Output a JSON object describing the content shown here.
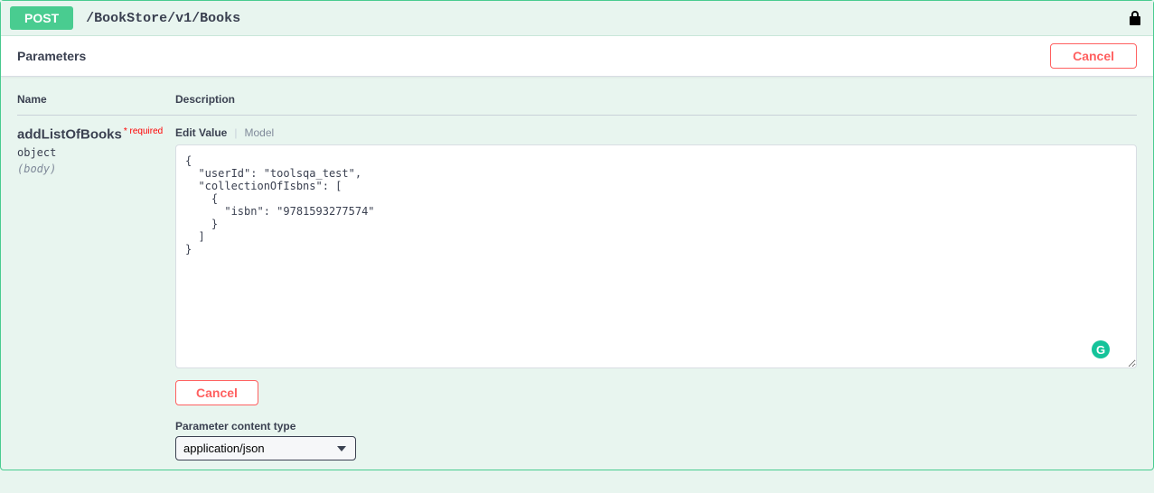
{
  "op": {
    "method": "POST",
    "path": "/BookStore/v1/Books"
  },
  "section": {
    "title": "Parameters",
    "cancel": "Cancel"
  },
  "cols": {
    "name": "Name",
    "desc": "Description"
  },
  "param": {
    "name": "addListOfBooks",
    "required_text": "* required",
    "type": "object",
    "in": "(body)"
  },
  "tabs": {
    "edit": "Edit Value",
    "model": "Model"
  },
  "body_value": "{\n  \"userId\": \"toolsqa_test\",\n  \"collectionOfIsbns\": [\n    {\n      \"isbn\": \"9781593277574\"\n    }\n  ]\n}",
  "param_cancel": "Cancel",
  "content_type": {
    "label": "Parameter content type",
    "selected": "application/json"
  },
  "grammarly": "G"
}
